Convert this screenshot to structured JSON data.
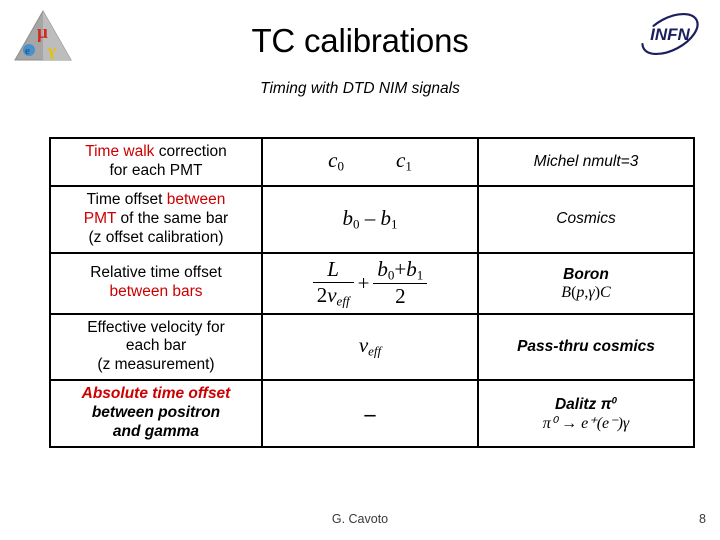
{
  "header": {
    "title": "TC calibrations",
    "subtitle": "Timing with  DTD NIM  signals",
    "left_logo_alt": "MEG experiment logo",
    "right_logo_text": "INFN"
  },
  "table": {
    "rows": [
      {
        "desc_parts": [
          {
            "text": "Time walk ",
            "color": "red"
          },
          {
            "text": "correction",
            "color": "black"
          },
          {
            "text": "for each PMT",
            "color": "black",
            "newline": true
          }
        ],
        "desc_plain": "Time walk correction for each PMT",
        "formula": "c0   c1",
        "source": "Michel nmult=3",
        "source_formula": ""
      },
      {
        "desc_parts": [
          {
            "text": "Time offset ",
            "color": "black"
          },
          {
            "text": "between",
            "color": "red"
          },
          {
            "text": "PMT",
            "color": "red",
            "newline": true
          },
          {
            "text": " of the same bar",
            "color": "black"
          },
          {
            "text": "(z offset calibration)",
            "color": "black",
            "newline": true
          }
        ],
        "desc_plain": "Time offset between PMT of the same bar (z offset calibration)",
        "formula": "b0 - b1",
        "source": "Cosmics",
        "source_formula": ""
      },
      {
        "desc_parts": [
          {
            "text": "Relative time offset",
            "color": "black"
          },
          {
            "text": "between bars",
            "color": "red",
            "newline": true
          }
        ],
        "desc_plain": "Relative time offset between bars",
        "formula": "L/(2 v_eff) + (b0 + b1)/2",
        "source": "Boron",
        "source_formula": "B(p,γ)C"
      },
      {
        "desc_parts": [
          {
            "text": "Effective velocity for",
            "color": "black"
          },
          {
            "text": "each bar",
            "color": "black",
            "newline": true
          },
          {
            "text": "(z measurement)",
            "color": "black",
            "newline": true
          }
        ],
        "desc_plain": "Effective velocity for each bar (z measurement)",
        "formula": "v_eff",
        "source": "Pass-thru cosmics",
        "source_formula": ""
      },
      {
        "desc_parts": [
          {
            "text": "Absolute time offset",
            "color": "red"
          },
          {
            "text": "between positron",
            "color": "black",
            "newline": true
          },
          {
            "text": "and gamma",
            "color": "black",
            "newline": true
          }
        ],
        "desc_plain": "Absolute time offset between positron and gamma",
        "formula": "-",
        "source": "Dalitz π0",
        "source_formula": "π0 → e+(e-)γ"
      }
    ]
  },
  "formulas": {
    "r1_c0": "c",
    "r1_c0_sub": "0",
    "r1_c1": "c",
    "r1_c1_sub": "1",
    "r2_b0": "b",
    "r2_b0_sub": "0",
    "r2_minus": "–",
    "r2_b1": "b",
    "r2_b1_sub": "1",
    "r3_L": "L",
    "r3_den_2": "2",
    "r3_den_v": "v",
    "r3_den_eff": "eff",
    "r3_plus": "+",
    "r3_num_b0": "b",
    "r3_num_b0_sub": "0",
    "r3_num_plus": "+",
    "r3_num_b1": "b",
    "r3_num_b1_sub": "1",
    "r3_den2": "2",
    "r4_v": "v",
    "r4_eff": "eff",
    "r5_dash": "–"
  },
  "sources": {
    "r1": "Michel nmult=3",
    "r2": "Cosmics",
    "r3_label": "Boron",
    "r3_reaction_B": "B",
    "r3_reaction_paren_open": "(",
    "r3_reaction_p": "p",
    "r3_reaction_comma": ",",
    "r3_reaction_gamma": "γ",
    "r3_reaction_paren_close": ")",
    "r3_reaction_C": "C",
    "r4": "Pass-thru cosmics",
    "r5_label_text": "Dalitz ",
    "r5_label_pi": "π",
    "r5_label_sup": "0",
    "r5_reaction": "π⁰ → e⁺(e⁻)γ"
  },
  "descriptions": {
    "r1_red": "Time walk",
    "r1_black": " correction",
    "r1_line2": "for each PMT",
    "r2_black1": "Time offset ",
    "r2_red1": "between",
    "r2_red2": "PMT",
    "r2_black2": " of the same bar",
    "r2_line3": "(z offset calibration)",
    "r3_line1": "Relative time offset",
    "r3_red": "between bars",
    "r4_line1": "Effective velocity for",
    "r4_line2": "each bar",
    "r4_line3": "(z measurement)",
    "r5_red": "Absolute time offset",
    "r5_line2": "between positron",
    "r5_line3": "and gamma"
  },
  "footer": {
    "author": "G. Cavoto",
    "page": "8"
  },
  "colors": {
    "accent_red": "#cc0000",
    "text_black": "#000000",
    "background": "#ffffff",
    "infn_navy": "#1b1f5e",
    "infn_cyan": "#29b6d8",
    "meg_gray": "#9a9a9a",
    "meg_mu_red": "#d12b20",
    "meg_e_blue": "#2f7fd0",
    "meg_gamma_yellow": "#e8c200"
  }
}
